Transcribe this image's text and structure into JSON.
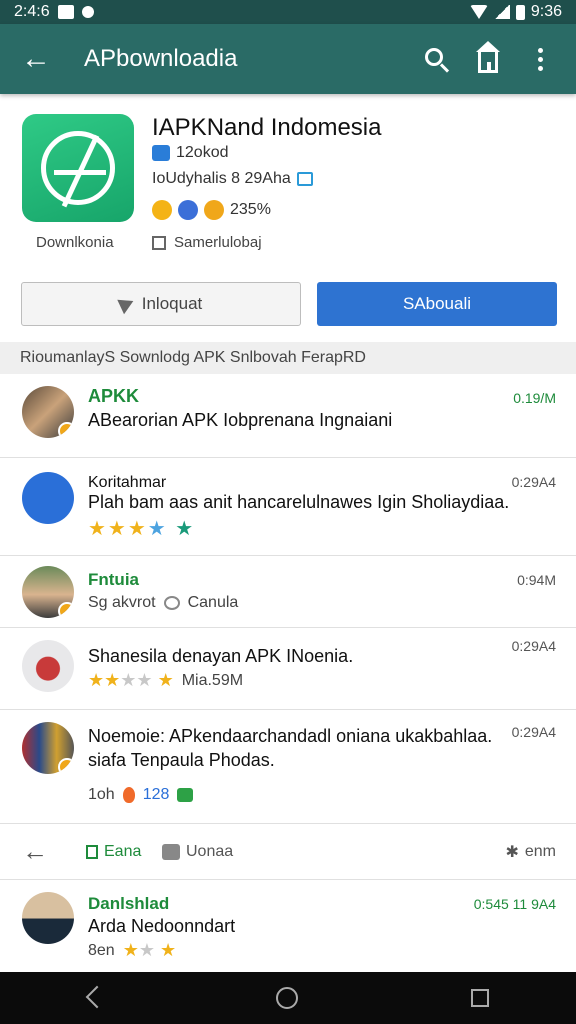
{
  "status_bar": {
    "time_left": "2:4:6",
    "time_right": "9:36"
  },
  "app_bar": {
    "title": "APbownloadia"
  },
  "app": {
    "name": "IAPKNand Indomesia",
    "meta_1": "12okod",
    "meta_2": "IoUdyhalis 8 29Aha",
    "rating": "235%",
    "downloads_label": "Downlkonia",
    "secondary_label": "Samerlulobaj"
  },
  "buttons": {
    "install": "Inloquat",
    "download": "SAbouali"
  },
  "section": {
    "header": "RioumanlayS Sownlodg APK Snlbovah FerapRD"
  },
  "feed": [
    {
      "title": "APKK",
      "text": "ABearorian APK Iobprenana Ingnaiani",
      "time": "0.19/M"
    },
    {
      "title": "Koritahmar",
      "text": "Plah bam aas anit hancarelulnawes Igin Sholiaydiaa.",
      "time": "0:29A4"
    },
    {
      "title": "Fntuia",
      "sub_1": "Sg akvrot",
      "sub_2": "Canula",
      "time": "0:94M"
    },
    {
      "text": "Shanesila denayan APK INoenia.",
      "sub": "Mia.59M",
      "time": "0:29A4"
    },
    {
      "text": "Noemoie: APkendaarchandadl oniana ukakbahlaa. siafa Tenpaula Phodas.",
      "count_1": "1oh",
      "count_2": "128",
      "time": "0:29A4"
    }
  ],
  "action_bar": {
    "item_1": "Eana",
    "item_2": "Uonaa",
    "item_3": "enm"
  },
  "last_row": {
    "title": "Danlshlad",
    "text": "Arda Nedoonndart",
    "sub": "8en",
    "time": "0:545 11 9A4"
  },
  "colors": {
    "app_bar": "#2a6b66",
    "status_bar": "#1f4f4c",
    "primary_button": "#2e73d1",
    "accent_green": "#1e8b3b"
  }
}
